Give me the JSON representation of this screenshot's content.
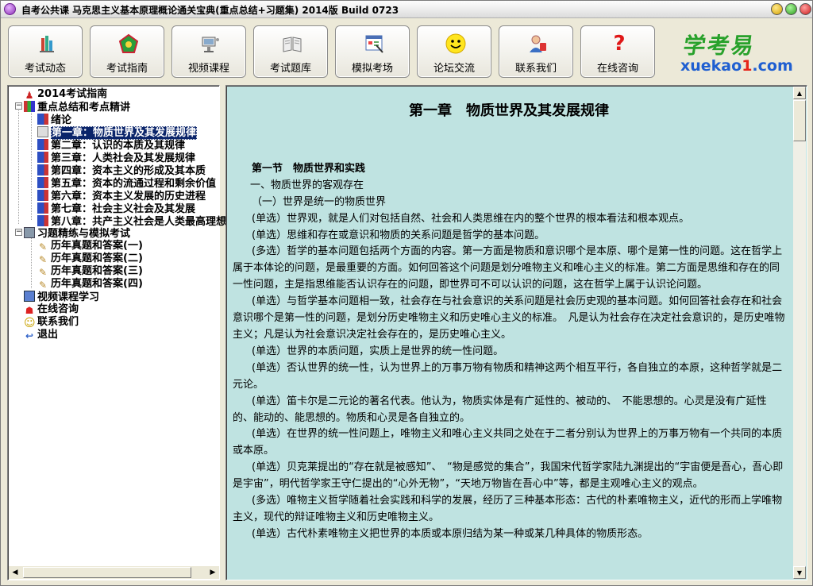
{
  "window": {
    "title": "自考公共课 马克思主义基本原理概论通关宝典(重点总结+习题集) 2014版 Build 0723"
  },
  "toolbar": {
    "buttons": [
      {
        "label": "考试动态",
        "icon": "news-icon"
      },
      {
        "label": "考试指南",
        "icon": "guide-icon"
      },
      {
        "label": "视频课程",
        "icon": "video-icon"
      },
      {
        "label": "考试题库",
        "icon": "book-icon"
      },
      {
        "label": "模拟考场",
        "icon": "exam-icon"
      },
      {
        "label": "论坛交流",
        "icon": "smiley-icon"
      },
      {
        "label": "联系我们",
        "icon": "contact-icon"
      },
      {
        "label": "在线咨询",
        "icon": "question-icon"
      }
    ],
    "logo_cn": "学考易",
    "logo_en_a": "xuekao",
    "logo_en_b": "1",
    "logo_en_c": ".com"
  },
  "tree": {
    "items": [
      {
        "label": "2014考试指南",
        "icon": "guide-icon"
      },
      {
        "label": "重点总结和考点精讲",
        "icon": "books-icon"
      },
      {
        "label": "绪论",
        "icon": "book-icon"
      },
      {
        "label": "第一章：物质世界及其发展规律",
        "icon": "open-book-icon"
      },
      {
        "label": "第二章：认识的本质及其规律",
        "icon": "book-icon"
      },
      {
        "label": "第三章：人类社会及其发展规律",
        "icon": "book-icon"
      },
      {
        "label": "第四章：资本主义的形成及其本质",
        "icon": "book-icon"
      },
      {
        "label": "第五章：资本的流通过程和剩余价值",
        "icon": "book-icon"
      },
      {
        "label": "第六章：资本主义发展的历史进程",
        "icon": "book-icon"
      },
      {
        "label": "第七章：社会主义社会及其发展",
        "icon": "book-icon"
      },
      {
        "label": "第八章：共产主义社会是人类最高理想",
        "icon": "book-icon"
      },
      {
        "label": "习题精练与模拟考试",
        "icon": "exercise-icon"
      },
      {
        "label": "历年真题和答案(一)",
        "icon": "pencil-icon"
      },
      {
        "label": "历年真题和答案(二)",
        "icon": "pencil-icon"
      },
      {
        "label": "历年真题和答案(三)",
        "icon": "pencil-icon"
      },
      {
        "label": "历年真题和答案(四)",
        "icon": "pencil-icon"
      },
      {
        "label": "视频课程学习",
        "icon": "video-icon"
      },
      {
        "label": "在线咨询",
        "icon": "help-icon"
      },
      {
        "label": "联系我们",
        "icon": "smiley-icon"
      },
      {
        "label": "退出",
        "icon": "exit-icon"
      }
    ]
  },
  "content": {
    "chapter_title": "第一章　物质世界及其发展规律",
    "section_title": "第一节　物质世界和实践",
    "heading1": "一、物质世界的客观存在",
    "heading2": "（一）世界是统一的物质世界",
    "paragraphs": [
      "(单选）世界观，就是人们对包括自然、社会和人类思维在内的整个世界的根本看法和根本观点。",
      "(单选）思维和存在或意识和物质的关系问题是哲学的基本问题。",
      "(多选）哲学的基本问题包括两个方面的内容。第一方面是物质和意识哪个是本原、哪个是第一性的问题。这在哲学上属于本体论的问题，是最重要的方面。如何回答这个问题是划分唯物主义和唯心主义的标准。第二方面是思维和存在的同一性问题，主是指思维能否认识存在的问题，即世界可不可以认识的问题，这在哲学上属于认识论问题。",
      "(单选）与哲学基本问题相一致，社会存在与社会意识的关系问题是社会历史观的基本问题。如何回答社会存在和社会意识哪个是第一性的问题，是划分历史唯物主义和历史唯心主义的标准。　凡是认为社会存在决定社会意识的，是历史唯物主义；凡是认为社会意识决定社会存在的，是历史唯心主义。",
      "(单选）世界的本质问题，实质上是世界的统一性问题。",
      "(单选）否认世界的统一性，认为世界上的万事万物有物质和精神这两个相互平行，各自独立的本原，这种哲学就是二元论。",
      "(单选）笛卡尔是二元论的著名代表。他认为，物质实体是有广延性的、被动的、　不能思想的。心灵是没有广延性的、能动的、能思想的。物质和心灵是各自独立的。",
      "(单选）在世界的统一性问题上，唯物主义和唯心主义共同之处在于二者分别认为世界上的万事万物有一个共同的本质或本原。",
      "(单选）贝克莱提出的“存在就是被感知”、　“物是感觉的集合”，我国宋代哲学家陆九渊提出的“宇宙便是吾心，吾心即是宇宙”，明代哲学家王守仁提出的“心外无物”，“天地万物皆在吾心中”等，都是主观唯心主义的观点。",
      "(多选）唯物主义哲学随着社会实践和科学的发展，经历了三种基本形态：古代的朴素唯物主义，近代的形而上学唯物主义，现代的辩证唯物主义和历史唯物主义。",
      "(单选）古代朴素唯物主义把世界的本质或本原归结为某一种或某几种具体的物质形态。"
    ]
  },
  "colors": {
    "content_bg": "#bfe3e1",
    "selection_bg": "#0a246a",
    "logo_green": "#28a12b",
    "logo_blue": "#1f5fd1",
    "logo_red": "#e6251a"
  }
}
